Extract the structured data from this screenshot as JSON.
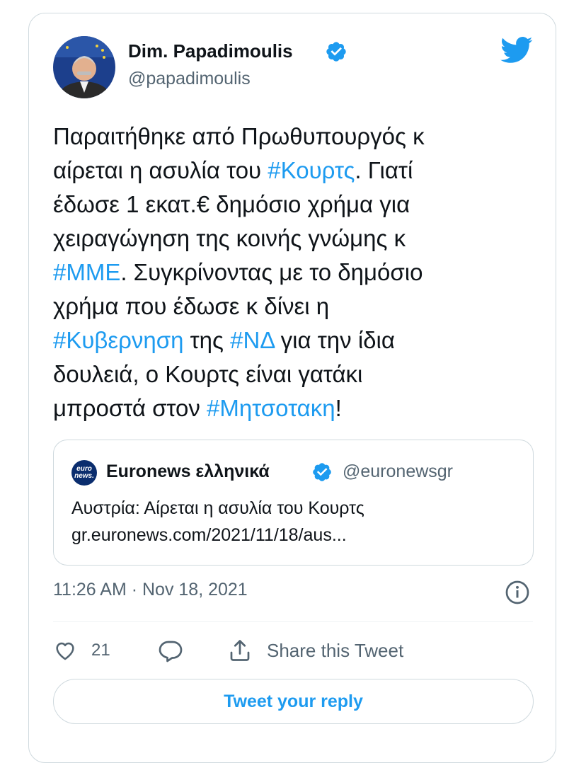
{
  "author": {
    "name": "Dim. Papadimoulis",
    "handle": "@papadimoulis",
    "avatar_icon": "person-avatar-photo",
    "verified_icon": "verified-badge-icon"
  },
  "tweet": {
    "lines": [
      [
        {
          "t": "Παραιτήθηκε από Πρωθυπουργός κ",
          "tag": false
        }
      ],
      [
        {
          "t": "αίρεται η ασυλία του ",
          "tag": false
        },
        {
          "t": "#Κουρτς",
          "tag": true
        },
        {
          "t": ". Γιατί",
          "tag": false
        }
      ],
      [
        {
          "t": "έδωσε 1 εκατ.€ δημόσιο χρήμα για",
          "tag": false
        }
      ],
      [
        {
          "t": "χειραγώγηση της κοινής γνώμης κ",
          "tag": false
        }
      ],
      [
        {
          "t": "#ΜΜΕ",
          "tag": true
        },
        {
          "t": ". Συγκρίνοντας με το δημόσιο",
          "tag": false
        }
      ],
      [
        {
          "t": "χρήμα που έδωσε κ δίνει η",
          "tag": false
        }
      ],
      [
        {
          "t": "#Κυβερνηση",
          "tag": true
        },
        {
          "t": " της ",
          "tag": false
        },
        {
          "t": "#ΝΔ",
          "tag": true
        },
        {
          "t": " για την ίδια",
          "tag": false
        }
      ],
      [
        {
          "t": "δουλειά, ο Κουρτς είναι γατάκι",
          "tag": false
        }
      ],
      [
        {
          "t": "μπροστά στον ",
          "tag": false
        },
        {
          "t": "#Μητσοτακη",
          "tag": true
        },
        {
          "t": "!",
          "tag": false
        }
      ]
    ],
    "timestamp": "11:26 AM · Nov 18, 2021"
  },
  "quote": {
    "logo_text_1": "euro",
    "logo_text_2": "news.",
    "name": "Euronews ελληνικά",
    "handle": "@euronewsgr",
    "text": "Αυστρία: Αίρεται η ασυλία του Κουρτς",
    "link": "gr.euronews.com/2021/11/18/aus..."
  },
  "actions": {
    "like_count": "21",
    "share_label": "Share this Tweet",
    "reply_button": "Tweet your reply"
  },
  "colors": {
    "accent": "#1d9bf0",
    "text": "#0f1419",
    "secondary": "#536471",
    "border": "#cfd9de"
  }
}
